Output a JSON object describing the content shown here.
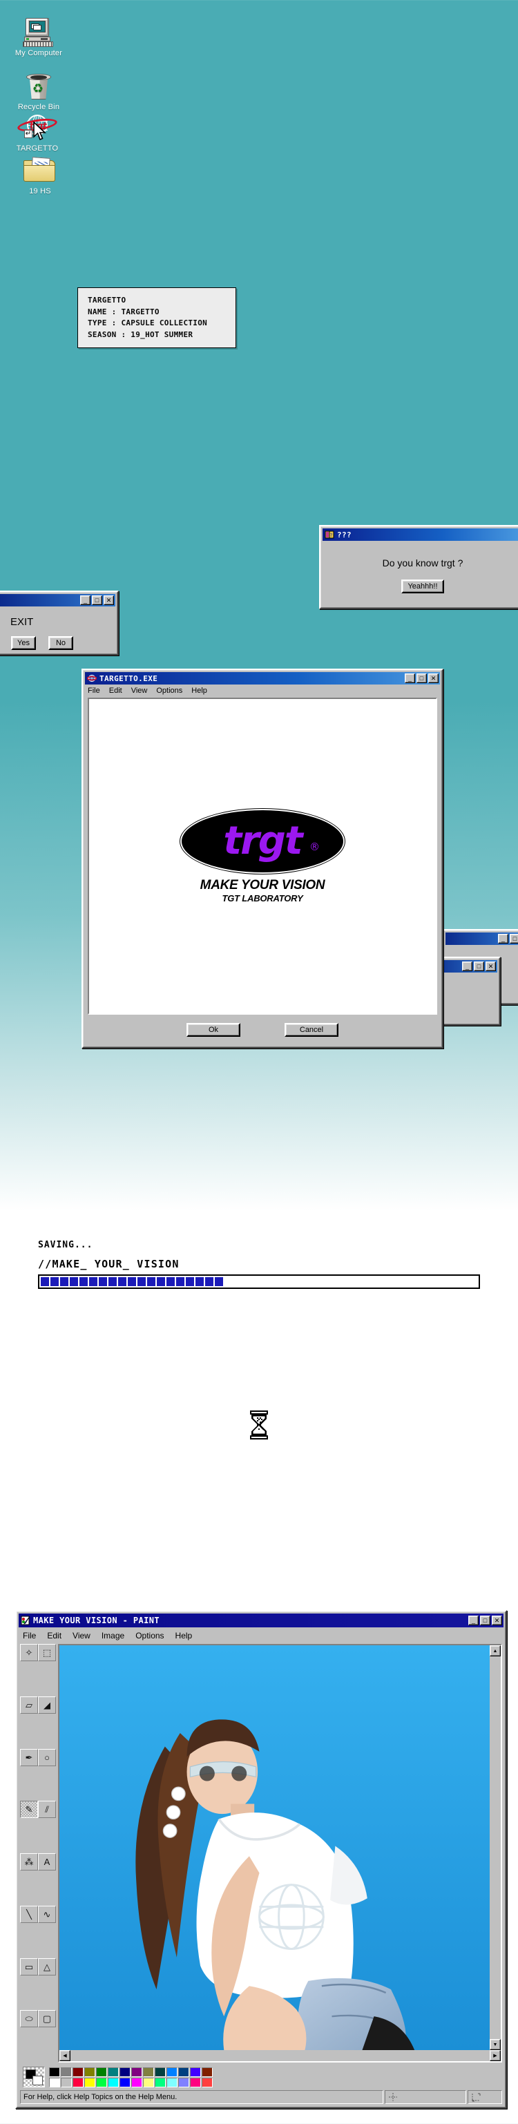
{
  "desktop": {
    "background_color": "#4aacb4",
    "icons": [
      {
        "label": "My Computer",
        "icon": "my-computer-icon"
      },
      {
        "label": "Recycle Bin",
        "icon": "recycle-bin-icon"
      },
      {
        "label": "TARGETTO",
        "icon": "targetto-globe-icon",
        "wordmark": "trgt"
      },
      {
        "label": "19 HS",
        "icon": "folder-icon"
      }
    ],
    "cursor": "arrow-pointer"
  },
  "infobox": {
    "title": "TARGETTO",
    "lines": [
      "NAME : TARGETTO",
      "TYPE : CAPSULE COLLECTION",
      "SEASON : 19_HOT SUMMER"
    ]
  },
  "question_dialog": {
    "title": "???",
    "title_icon": "help-book-icon",
    "message": "Do you know trgt ?",
    "button": "Yeahhh!!",
    "min_btn": "_",
    "max_btn": "□",
    "close_btn": "✕"
  },
  "exit_dialog": {
    "title": "",
    "message": "EXIT",
    "yes": "Yes",
    "no": "No",
    "min_btn": "_",
    "max_btn": "□",
    "close_btn": "✕"
  },
  "targetto_exe": {
    "title": "TARGETTO.EXE",
    "title_icon": "globe-icon",
    "menu": [
      "File",
      "Edit",
      "View",
      "Options",
      "Help"
    ],
    "logo": {
      "wordmark": "trgt",
      "registered": "®",
      "tagline": "MAKE YOUR VISION",
      "subtagline": "TGT LABORATORY",
      "wordmark_color": "#9b18f0",
      "ellipse_color": "#000000"
    },
    "ok": "Ok",
    "cancel": "Cancel",
    "min_btn": "_",
    "max_btn": "□",
    "close_btn": "✕"
  },
  "saving": {
    "status": "SAVING...",
    "path": "//MAKE_ YOUR_ VISION",
    "progress_blocks_total": 29,
    "progress_blocks_filled": 19,
    "progress_color": "#1b1bb8"
  },
  "wait_cursor": {
    "icon": "hourglass-icon"
  },
  "paint": {
    "title": "MAKE YOUR VISION - PAINT",
    "title_icon": "paint-icon",
    "menu": [
      "File",
      "Edit",
      "View",
      "Image",
      "Options",
      "Help"
    ],
    "min_btn": "_",
    "max_btn": "□",
    "close_btn": "✕",
    "tools": [
      "free-form-select",
      "rectangle-select",
      "eraser",
      "fill-bucket",
      "eyedropper",
      "magnifier",
      "pencil",
      "brush",
      "airbrush",
      "text",
      "line",
      "curve",
      "rectangle",
      "polygon",
      "ellipse",
      "rounded-rectangle"
    ],
    "selected_tool": "pencil",
    "palette_row1": [
      "#000000",
      "#808080",
      "#800000",
      "#808000",
      "#008000",
      "#008080",
      "#000080",
      "#800080",
      "#808040",
      "#004040",
      "#0080ff",
      "#004080",
      "#4000ff",
      "#802000"
    ],
    "palette_row2": [
      "#ffffff",
      "#c0c0c0",
      "#ff0040",
      "#ffff00",
      "#00ff40",
      "#00ffff",
      "#0000ff",
      "#ff00ff",
      "#ffff80",
      "#00ff80",
      "#80ffff",
      "#8080ff",
      "#ff0080",
      "#ff4040"
    ],
    "foreground_color": "#000000",
    "background_color": "#ffffff",
    "status_text": "For Help, click Help Topics on the Help Menu.",
    "canvas_alt": "model in white trgt t-shirt on blue background"
  }
}
